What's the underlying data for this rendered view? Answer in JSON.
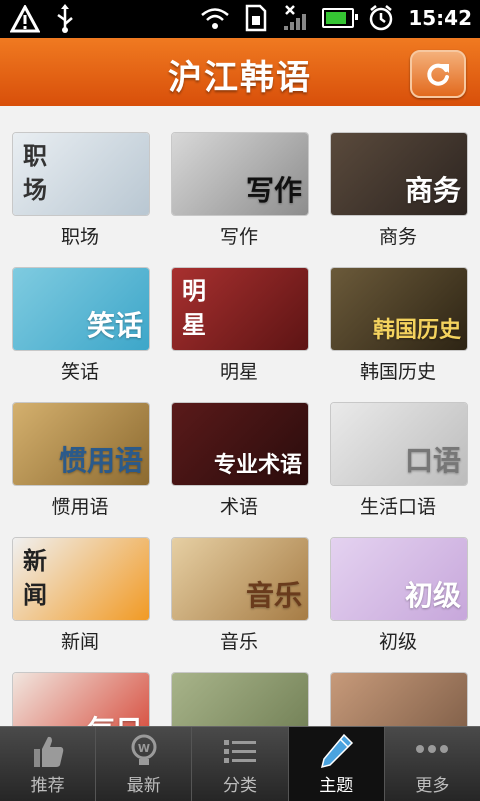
{
  "statusbar": {
    "time": "15:42"
  },
  "header": {
    "title": "沪江韩语"
  },
  "topics": [
    {
      "label": "职场",
      "art": [
        "#e9eef2",
        "#b9c7d2"
      ],
      "thumb_text": "职\n场",
      "text_color": "#333"
    },
    {
      "label": "写作",
      "art": [
        "#d8d8d8",
        "#8d8d8d"
      ],
      "thumb_text": "写作",
      "text_color": "#111"
    },
    {
      "label": "商务",
      "art": [
        "#5a4a3c",
        "#2c2420"
      ],
      "thumb_text": "商务",
      "text_color": "#fff"
    },
    {
      "label": "笑话",
      "art": [
        "#7fcbe0",
        "#3da6c9"
      ],
      "thumb_text": "笑话",
      "text_color": "#fff"
    },
    {
      "label": "明星",
      "art": [
        "#a8302f",
        "#5d1414"
      ],
      "thumb_text": "明\n星",
      "text_color": "#fff"
    },
    {
      "label": "韩国历史",
      "art": [
        "#6b5a3a",
        "#2d2414"
      ],
      "thumb_text": "韩国历史",
      "text_color": "#f4d35e"
    },
    {
      "label": "惯用语",
      "art": [
        "#d4b06e",
        "#8c6a30"
      ],
      "thumb_text": "惯用语",
      "text_color": "#2b5a8a"
    },
    {
      "label": "术语",
      "art": [
        "#5a1a1a",
        "#2a0c0c"
      ],
      "thumb_text": "专业术语",
      "text_color": "#fff"
    },
    {
      "label": "生活口语",
      "art": [
        "#eaeaea",
        "#bcbcbc"
      ],
      "thumb_text": "口语",
      "text_color": "#777"
    },
    {
      "label": "新闻",
      "art": [
        "#f0f0f0",
        "#f19a24"
      ],
      "thumb_text": "新\n闻",
      "text_color": "#222"
    },
    {
      "label": "音乐",
      "art": [
        "#e6cfa3",
        "#a67c45"
      ],
      "thumb_text": "音乐",
      "text_color": "#6a3b1c"
    },
    {
      "label": "初级",
      "art": [
        "#e4d2f0",
        "#c7a7db"
      ],
      "thumb_text": "初级",
      "text_color": "#fff"
    },
    {
      "label": "",
      "art": [
        "#f1e6df",
        "#d44030"
      ],
      "thumb_text": "每日",
      "text_color": "#fff"
    },
    {
      "label": "",
      "art": [
        "#a8b48a",
        "#6e7c52"
      ],
      "thumb_text": "",
      "text_color": "#fff"
    },
    {
      "label": "",
      "art": [
        "#c79a7a",
        "#7a5a44"
      ],
      "thumb_text": "",
      "text_color": "#fff"
    }
  ],
  "nav": [
    {
      "label": "推荐",
      "icon": "thumbs-up-icon"
    },
    {
      "label": "最新",
      "icon": "lightbulb-icon"
    },
    {
      "label": "分类",
      "icon": "list-icon"
    },
    {
      "label": "主题",
      "icon": "pencil-icon",
      "active": true
    },
    {
      "label": "更多",
      "icon": "more-dots-icon"
    }
  ]
}
